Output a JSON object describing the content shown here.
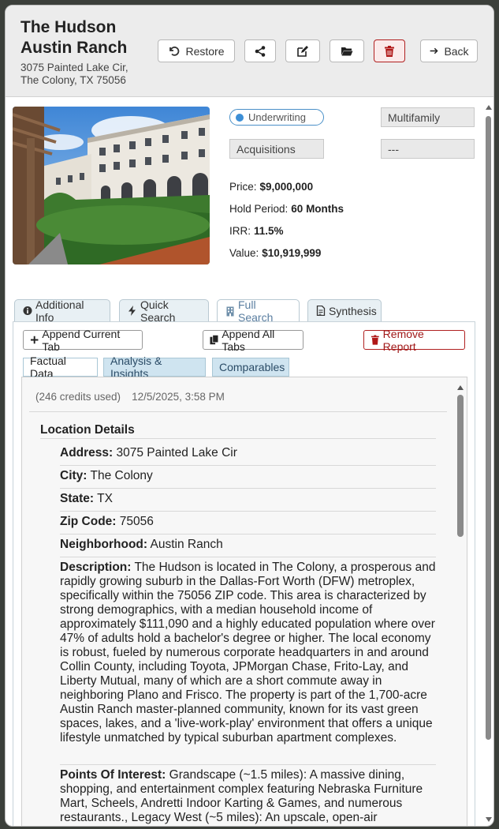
{
  "property": {
    "name": "The Hudson Austin Ranch",
    "address_line1": "3075 Painted Lake Cir,",
    "address_line2": "The Colony, TX 75056"
  },
  "toolbar": {
    "restore_label": "Restore",
    "back_label": "Back"
  },
  "summary": {
    "status": "Underwriting",
    "asset_type": "Multifamily",
    "team": "Acquisitions",
    "extra": "---",
    "price_label": "Price:",
    "price_value": "$9,000,000",
    "hold_label": "Hold Period:",
    "hold_value": "60 Months",
    "irr_label": "IRR:",
    "irr_value": "11.5%",
    "value_label": "Value:",
    "value_value": "$10,919,999"
  },
  "tabs": [
    {
      "label": "Additional Info",
      "icon": "info-circle-icon"
    },
    {
      "label": "Quick Search",
      "icon": "bolt-icon"
    },
    {
      "label": "Full Search",
      "icon": "building-icon",
      "active": true
    },
    {
      "label": "Synthesis",
      "icon": "document-icon"
    }
  ],
  "actions": {
    "append_current": "Append Current Tab",
    "append_all": "Append All Tabs",
    "remove_report": "Remove Report"
  },
  "subtabs": [
    {
      "label": "Factual Data",
      "active": true
    },
    {
      "label": "Analysis & Insights"
    },
    {
      "label": "Comparables"
    }
  ],
  "report": {
    "credits": "(246 credits used)",
    "timestamp": "12/5/2025, 3:58 PM",
    "section_title": "Location Details",
    "fields": [
      {
        "label": "Address:",
        "value": "3075 Painted Lake Cir"
      },
      {
        "label": "City:",
        "value": "The Colony"
      },
      {
        "label": "State:",
        "value": "TX"
      },
      {
        "label": "Zip Code:",
        "value": "75056"
      },
      {
        "label": "Neighborhood:",
        "value": "Austin Ranch"
      },
      {
        "label": "Description:",
        "value": "The Hudson is located in The Colony, a prosperous and rapidly growing suburb in the Dallas-Fort Worth (DFW) metroplex, specifically within the 75056 ZIP code. This area is characterized by strong demographics, with a median household income of approximately $111,090 and a highly educated population where over 47% of adults hold a bachelor's degree or higher. The local economy is robust, fueled by numerous corporate headquarters in and around Collin County, including Toyota, JPMorgan Chase, Frito-Lay, and Liberty Mutual, many of which are a short commute away in neighboring Plano and Frisco. The property is part of the 1,700-acre Austin Ranch master-planned community, known for its vast green spaces, lakes, and a 'live-work-play' environment that offers a unique lifestyle unmatched by typical suburban apartment complexes."
      },
      {
        "label": "Points Of Interest:",
        "value": "Grandscape (~1.5 miles): A massive dining, shopping, and entertainment complex featuring Nebraska Furniture Mart, Scheels, Andretti Indoor Karting & Games, and numerous restaurants., Legacy West (~5 miles): An upscale, open-air"
      }
    ]
  }
}
